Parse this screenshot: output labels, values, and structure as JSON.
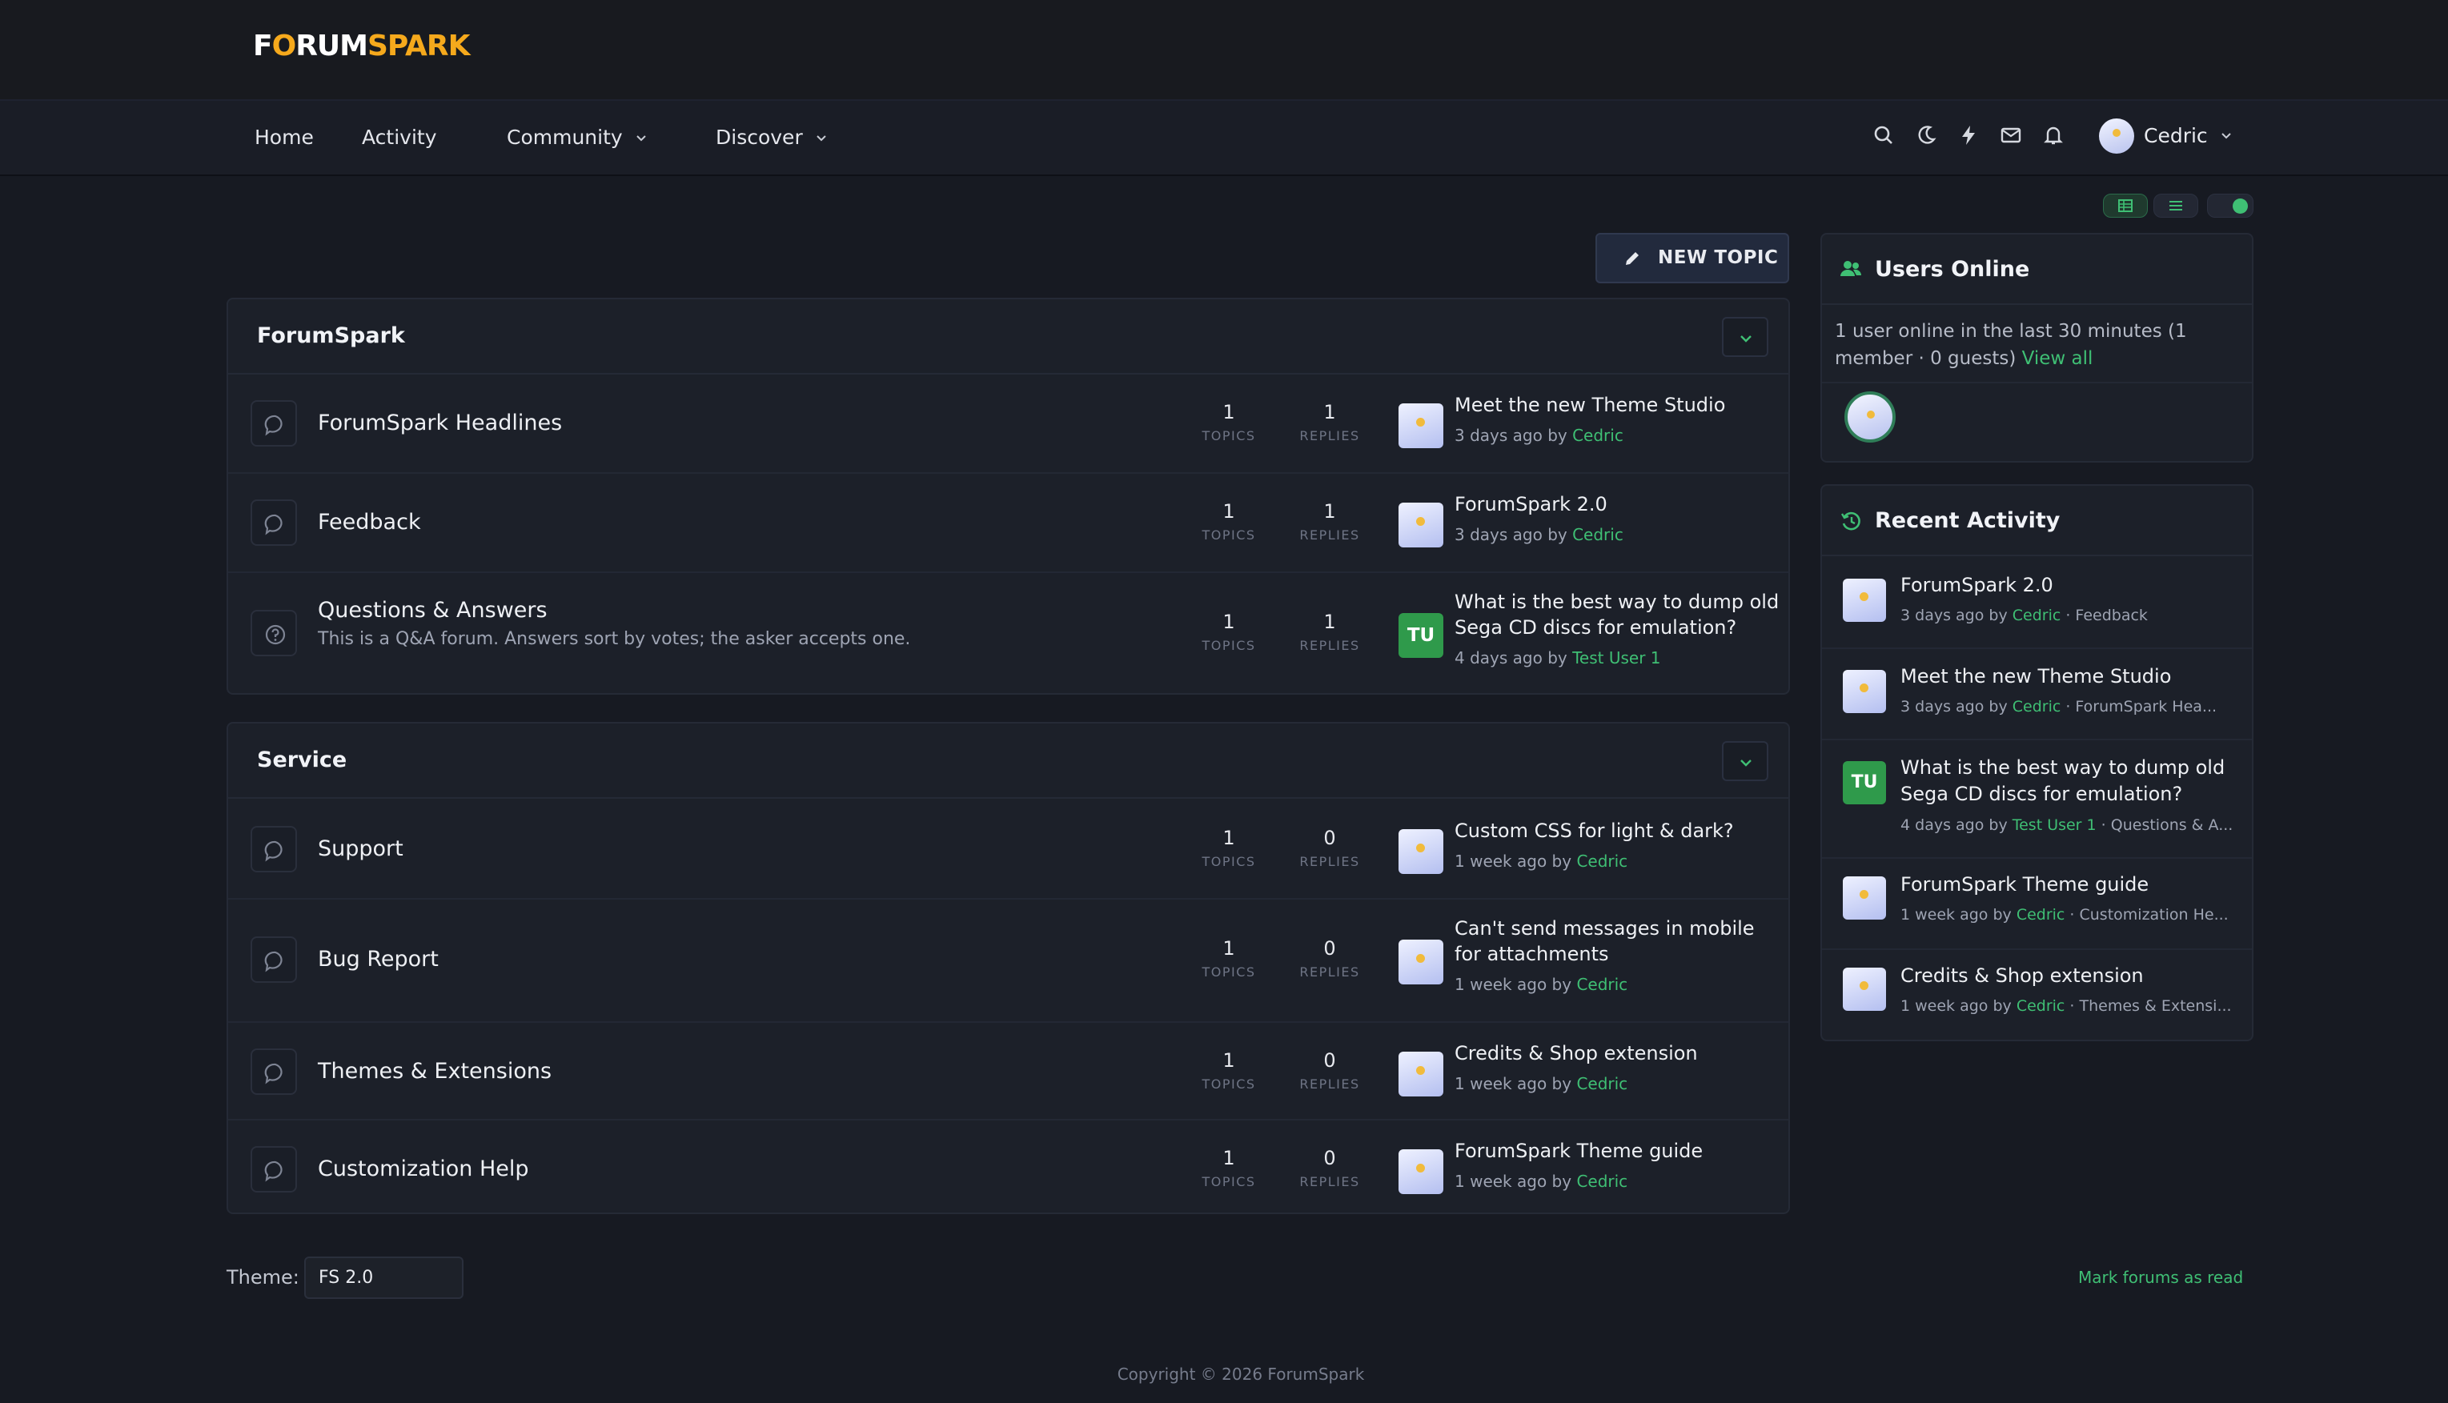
{
  "brand": {
    "part1": "F",
    "part2": "O",
    "part3": "RUM",
    "part4": "SPARK",
    "accent": "#f5a91c"
  },
  "nav": {
    "home": "Home",
    "activity": "Activity",
    "community": "Community",
    "discover": "Discover",
    "icons": [
      "search-icon",
      "moon-icon",
      "bolt-icon",
      "mail-icon",
      "bell-icon"
    ],
    "user": "Cedric"
  },
  "toolbar": {
    "new_topic": "NEW TOPIC",
    "views": [
      "table-view-icon",
      "list-view-icon",
      "toggle-switch"
    ]
  },
  "categories": [
    {
      "title": "ForumSpark",
      "forums": [
        {
          "name": "ForumSpark Headlines",
          "desc": "",
          "topics": "1",
          "replies": "1",
          "last_title": "Meet the new Theme Studio",
          "last_time": "3 days ago by",
          "last_user": "Cedric",
          "avatar": "image"
        },
        {
          "name": "Feedback",
          "desc": "",
          "topics": "1",
          "replies": "1",
          "last_title": "ForumSpark 2.0",
          "last_time": "3 days ago by",
          "last_user": "Cedric",
          "avatar": "image"
        },
        {
          "name": "Questions & Answers",
          "desc": "This is a Q&A forum. Answers sort by votes; the asker accepts one.",
          "topics": "1",
          "replies": "1",
          "last_title_1": "What is the best way to dump old",
          "last_title_2": "Sega CD discs for emulation?",
          "last_time": "4 days ago by",
          "last_user": "Test User 1",
          "avatar": "TU"
        }
      ]
    },
    {
      "title": "Service",
      "forums": [
        {
          "name": "Support",
          "topics": "1",
          "replies": "0",
          "last_title": "Custom CSS for light & dark?",
          "last_time": "1 week ago by",
          "last_user": "Cedric"
        },
        {
          "name": "Bug Report",
          "topics": "1",
          "replies": "0",
          "last_title_1": "Can't send messages in mobile",
          "last_title_2": "for attachments",
          "last_time": "1 week ago by",
          "last_user": "Cedric"
        },
        {
          "name": "Themes & Extensions",
          "topics": "1",
          "replies": "0",
          "last_title": "Credits & Shop extension",
          "last_time": "1 week ago by",
          "last_user": "Cedric"
        },
        {
          "name": "Customization Help",
          "topics": "1",
          "replies": "0",
          "last_title": "ForumSpark Theme guide",
          "last_time": "1 week ago by",
          "last_user": "Cedric"
        }
      ]
    }
  ],
  "labels": {
    "topics": "TOPICS",
    "replies": "REPLIES"
  },
  "users_online": {
    "title": "Users Online",
    "text": "1 user online in the last 30 minutes (1 member · 0 guests)",
    "view_all": "View all"
  },
  "recent_activity": {
    "title": "Recent Activity",
    "items": [
      {
        "title": "ForumSpark 2.0",
        "time": "3 days ago by",
        "user": "Cedric",
        "forum": "· Feedback"
      },
      {
        "title": "Meet the new Theme Studio",
        "time": "3 days ago by",
        "user": "Cedric",
        "forum": "· ForumSpark Hea..."
      },
      {
        "title": "What is the best way to dump old Sega CD discs for emulation?",
        "time": "4 days ago by",
        "user": "Test User 1",
        "forum": "· Questions & A...",
        "avatar": "TU"
      },
      {
        "title": "ForumSpark Theme guide",
        "time": "1 week ago by",
        "user": "Cedric",
        "forum": "· Customization He..."
      },
      {
        "title": "Credits & Shop extension",
        "time": "1 week ago by",
        "user": "Cedric",
        "forum": "· Themes & Extensi..."
      }
    ]
  },
  "footer": {
    "theme_label": "Theme:",
    "theme_value": "FS 2.0",
    "mark_read": "Mark forums as read",
    "copyright": "Copyright © 2026 ForumSpark"
  }
}
